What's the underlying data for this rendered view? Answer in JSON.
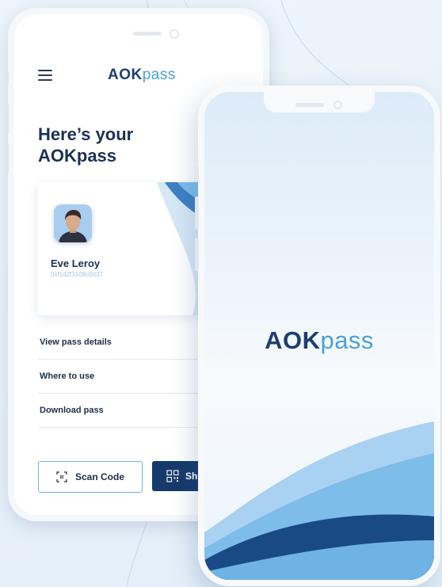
{
  "back_phone": {
    "logo": {
      "strong": "AOK",
      "light": "pass"
    },
    "title_line1": "Here’s your",
    "title_line2": "AOKpass",
    "pass_card": {
      "name": "Eve Leroy",
      "id": "0xf1d2f3108c0d37"
    },
    "menu": [
      {
        "label": "View pass details"
      },
      {
        "label": "Where to use"
      },
      {
        "label": "Download pass"
      }
    ],
    "scan_button": {
      "label": "Scan Code",
      "icon": "qr-scan-icon"
    },
    "show_button": {
      "label": "Show",
      "icon": "qr-code-icon"
    }
  },
  "front_phone": {
    "logo": {
      "strong": "AOK",
      "light": "pass"
    }
  },
  "colors": {
    "primary": "#163a6b",
    "accent": "#4aa0da",
    "wave_light": "#7ebde9",
    "wave_dark": "#1a4a86"
  }
}
